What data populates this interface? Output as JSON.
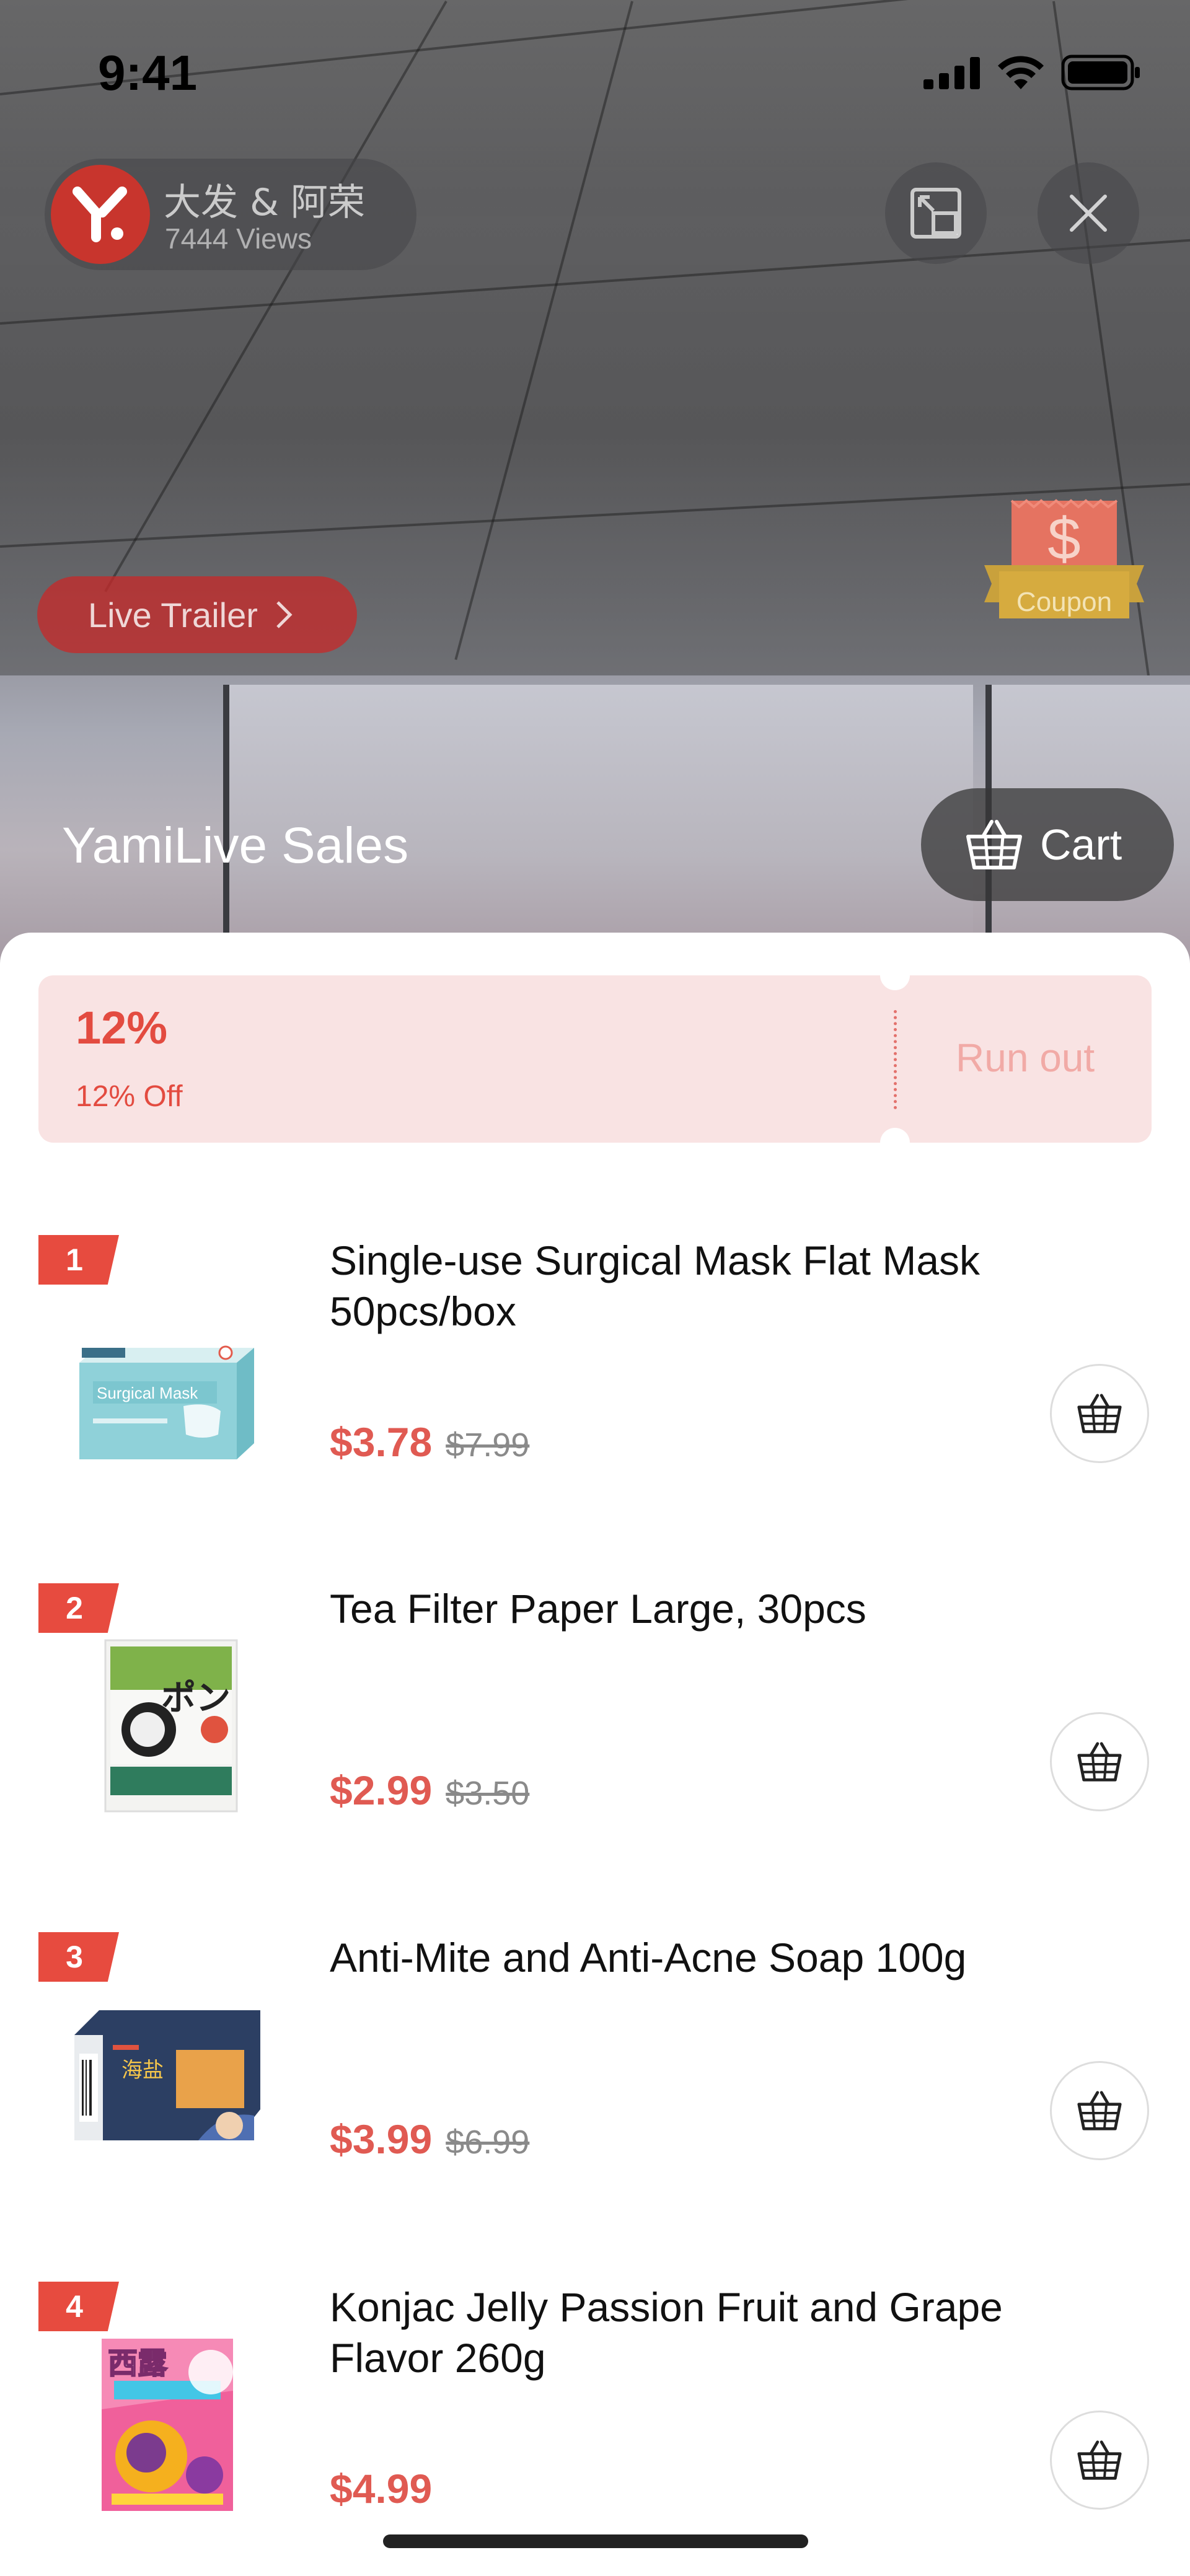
{
  "status_bar": {
    "time": "9:41"
  },
  "host": {
    "name": "大发 & 阿荣",
    "views": "7444 Views"
  },
  "live_trailer": {
    "label": "Live Trailer"
  },
  "coupon_badge": {
    "symbol": "$",
    "label": "Coupon"
  },
  "header": {
    "title": "YamiLive Sales",
    "cart_label": "Cart"
  },
  "coupon_card": {
    "percent": "12%",
    "description": "12% Off",
    "status": "Run out"
  },
  "products": [
    {
      "rank": "1",
      "name": "Single-use Surgical Mask Flat Mask 50pcs/box",
      "price": "$3.78",
      "original_price": "$7.99",
      "thumb_text": "Surgical Mask"
    },
    {
      "rank": "2",
      "name": "Tea Filter Paper Large, 30pcs",
      "price": "$2.99",
      "original_price": "$3.50",
      "thumb_text": "ポン"
    },
    {
      "rank": "3",
      "name": "Anti-Mite and Anti-Acne Soap 100g",
      "price": "$3.99",
      "original_price": "$6.99",
      "thumb_text": "海盐"
    },
    {
      "rank": "4",
      "name": "Konjac Jelly  Passion Fruit and Grape Flavor 260g",
      "price": "$4.99",
      "original_price": "",
      "thumb_text": "西露"
    }
  ],
  "colors": {
    "accent_red": "#e74b3f",
    "price_red": "#e05a52",
    "coupon_bg": "#f9e3e3"
  }
}
